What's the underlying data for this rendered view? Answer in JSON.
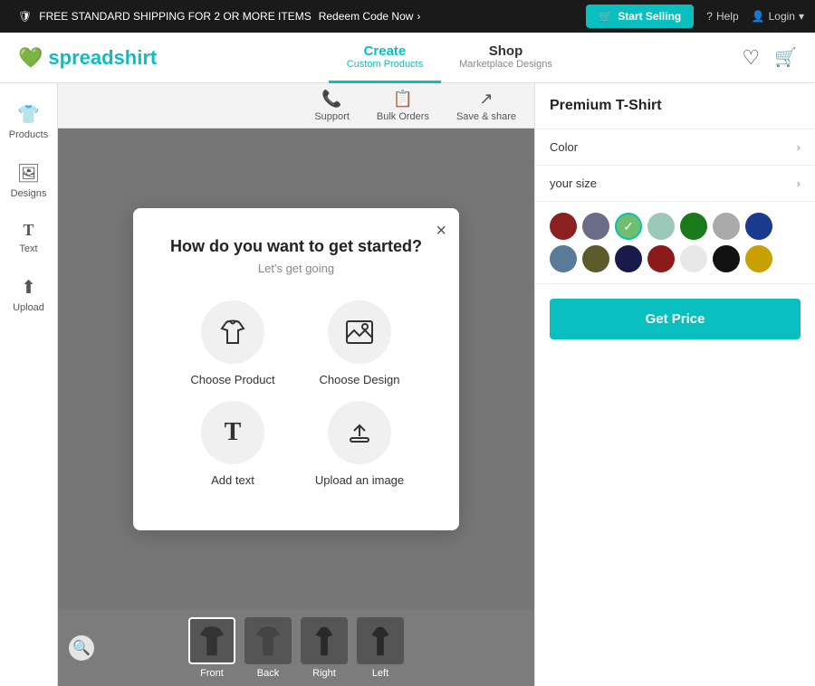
{
  "topbar": {
    "announcement": "FREE STANDARD SHIPPING FOR 2 OR MORE ITEMS",
    "redeem": "Redeem Code Now",
    "redeem_arrow": "›",
    "start_selling": "Start Selling",
    "start_selling_icon": "🛒",
    "help": "Help",
    "login": "Login",
    "login_arrow": "▾"
  },
  "header": {
    "logo_text": "spreadshirt",
    "nav": [
      {
        "id": "create",
        "main": "Create",
        "sub": "Custom Products",
        "active": true
      },
      {
        "id": "shop",
        "main": "Shop",
        "sub": "Marketplace Designs",
        "active": false
      }
    ],
    "wishlist_icon": "♡",
    "cart_icon": "🛒"
  },
  "sidebar": {
    "items": [
      {
        "id": "products",
        "icon": "👕",
        "label": "Products"
      },
      {
        "id": "designs",
        "icon": "🖼",
        "label": "Designs"
      },
      {
        "id": "text",
        "icon": "T",
        "label": "Text"
      },
      {
        "id": "upload",
        "icon": "⬆",
        "label": "Upload"
      }
    ]
  },
  "canvas": {
    "toolbar": [
      {
        "id": "support",
        "icon": "📞",
        "label": "Support"
      },
      {
        "id": "bulk",
        "icon": "📋",
        "label": "Bulk Orders"
      },
      {
        "id": "save",
        "icon": "↗",
        "label": "Save & share"
      }
    ],
    "thumbnails": [
      {
        "id": "front",
        "label": "Front",
        "active": true
      },
      {
        "id": "back",
        "label": "Back",
        "active": false
      },
      {
        "id": "right",
        "label": "Right",
        "active": false
      },
      {
        "id": "left",
        "label": "Left",
        "active": false
      }
    ],
    "zoom_icon": "🔍"
  },
  "right_panel": {
    "product_name": "Premium T-Shirt",
    "option_color": "Color",
    "option_size": "your size",
    "colors": [
      {
        "hex": "#8B2020",
        "selected": false
      },
      {
        "hex": "#6b6b8a",
        "selected": false
      },
      {
        "hex": "#6fbf6f",
        "selected": true
      },
      {
        "hex": "#9bc8b8",
        "selected": false
      },
      {
        "hex": "#1a7a1a",
        "selected": false
      },
      {
        "hex": "#aaaaaa",
        "selected": false
      },
      {
        "hex": "#1a3a8f",
        "selected": false
      },
      {
        "hex": "#5a7a9a",
        "selected": false
      },
      {
        "hex": "#5a5a2a",
        "selected": false
      },
      {
        "hex": "#1a1a4a",
        "selected": false
      },
      {
        "hex": "#8B1a1a",
        "selected": false
      },
      {
        "hex": "#e8e8e8",
        "selected": false
      },
      {
        "hex": "#111111",
        "selected": false
      },
      {
        "hex": "#c8a000",
        "selected": false
      }
    ],
    "get_price_label": "Get Price"
  },
  "modal": {
    "title": "How do you want to get started?",
    "subtitle": "Let's get going",
    "close_icon": "×",
    "options": [
      {
        "id": "choose-product",
        "icon": "👕",
        "label": "Choose Product"
      },
      {
        "id": "choose-design",
        "icon": "🖼",
        "label": "Choose Design"
      },
      {
        "id": "add-text",
        "icon": "T",
        "label": "Add text"
      },
      {
        "id": "upload-image",
        "icon": "⬆",
        "label": "Upload an image"
      }
    ]
  }
}
